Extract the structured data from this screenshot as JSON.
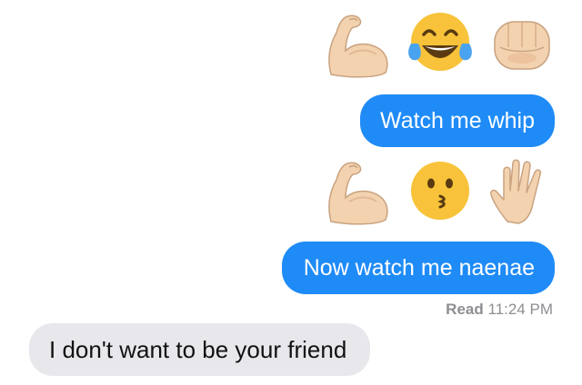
{
  "emoji_rows": [
    {
      "emojis": [
        "flexed-biceps-icon",
        "tears-of-joy-face-icon",
        "oncoming-fist-icon"
      ]
    },
    {
      "emojis": [
        "flexed-biceps-icon",
        "kissing-face-icon",
        "raised-hand-icon"
      ]
    }
  ],
  "messages": [
    {
      "direction": "outgoing",
      "text": "Watch me whip"
    },
    {
      "direction": "outgoing",
      "text": "Now watch me naenae"
    },
    {
      "direction": "incoming",
      "text": "I don't want to be your friend"
    }
  ],
  "receipt": {
    "status": "Read",
    "time": "11:24 PM"
  },
  "colors": {
    "outgoing_bubble": "#1f8bf7",
    "incoming_bubble": "#e8e7ec",
    "receipt_text": "#8e8e93",
    "emoji_yellow": "#f8c33a",
    "skin": "#f3d2b0"
  }
}
